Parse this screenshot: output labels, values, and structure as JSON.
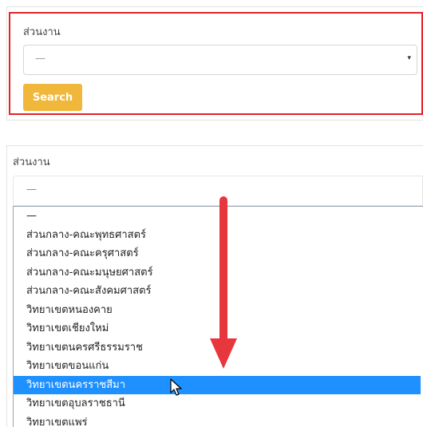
{
  "top_form": {
    "label": "ส่วนงาน",
    "select_value": "—",
    "caret": "▾",
    "search_label": "Search"
  },
  "bottom_form": {
    "label": "ส่วนงาน",
    "select_value": "—",
    "options": [
      "—",
      "ส่วนกลาง-คณะพุทธศาสตร์",
      "ส่วนกลาง-คณะครุศาสตร์",
      "ส่วนกลาง-คณะมนุษยศาสตร์",
      "ส่วนกลาง-คณะสังคมศาสตร์",
      "วิทยาเขตหนองคาย",
      "วิทยาเขตเชียงใหม่",
      "วิทยาเขตนครศรีธรรมราช",
      "วิทยาเขตขอนแก่น",
      "วิทยาเขตนครราชสีมา",
      "วิทยาเขตอุบลราชธานี",
      "วิทยาเขตแพร่"
    ],
    "selected_index": 9
  },
  "colors": {
    "highlight_border": "#e3222a",
    "search_button": "#f1b73a",
    "selected_option": "#1e90ff",
    "arrow": "#e8373c"
  }
}
